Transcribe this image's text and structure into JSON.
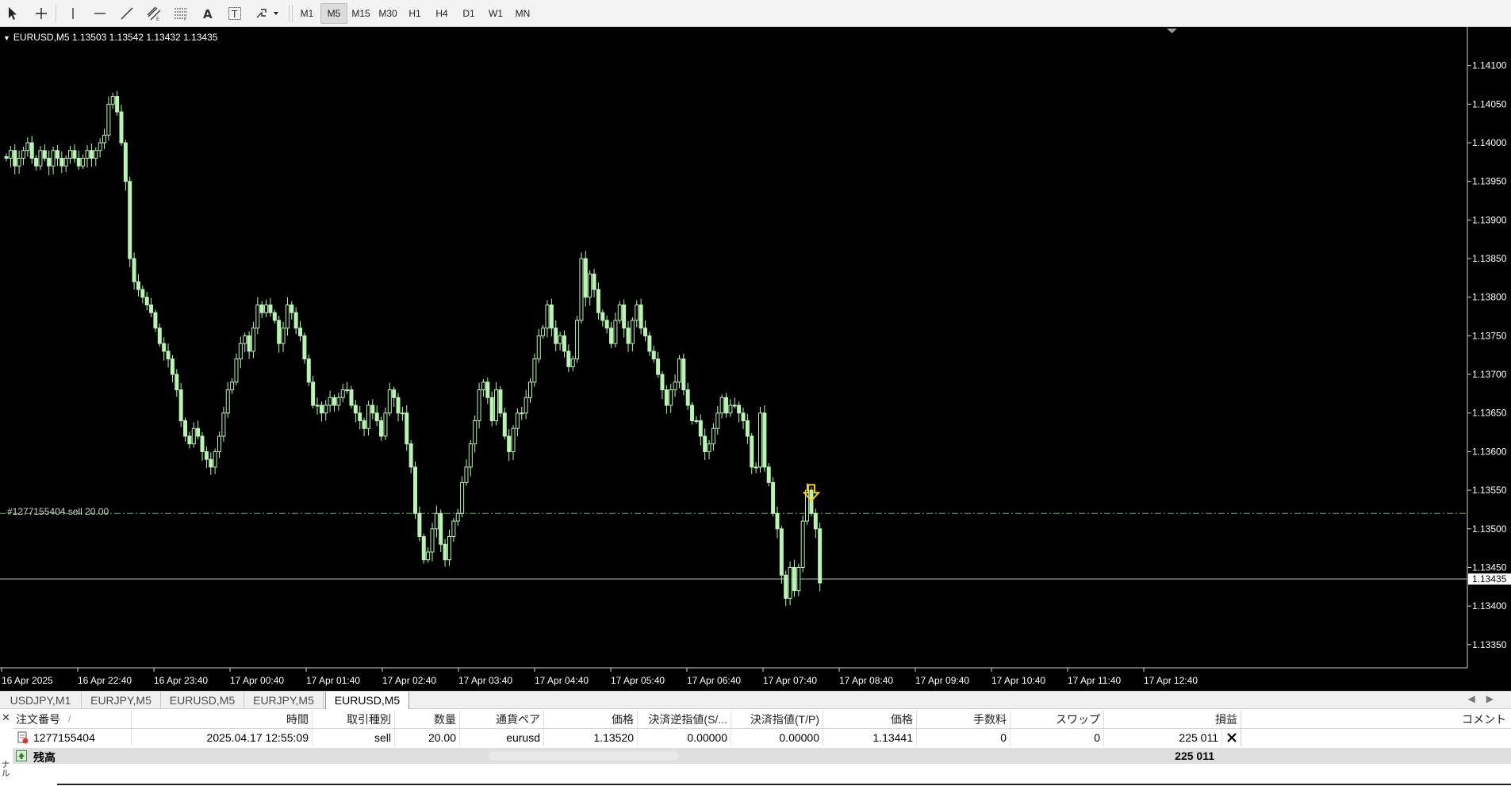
{
  "toolbar": {
    "timeframes": [
      "M1",
      "M5",
      "M15",
      "M30",
      "H1",
      "H4",
      "D1",
      "W1",
      "MN"
    ],
    "active_timeframe": "M5",
    "tools": [
      "cursor-icon",
      "crosshair-icon",
      "vertical-line-icon",
      "horizontal-line-icon",
      "trendline-icon",
      "equidistant-channel-icon",
      "fibonacci-icon",
      "text-icon",
      "text-label-icon",
      "arrows-icon"
    ]
  },
  "chart": {
    "title": "EURUSD,M5  1.13503 1.13542 1.13432 1.13435",
    "order_label": "#1277155404 sell 20.00",
    "current_price_label": "1.13435",
    "colors": {
      "background": "#000000",
      "candle": "#b8f5b0",
      "order_line": "#5fa85f",
      "arrow": "#ffd400",
      "axis_text": "#ffffff"
    }
  },
  "chart_data": {
    "type": "candlestick",
    "symbol": "EURUSD",
    "timeframe": "M5",
    "ylim": [
      1.1332,
      1.1415
    ],
    "price_ticks": [
      "1.14100",
      "1.14050",
      "1.14000",
      "1.13950",
      "1.13900",
      "1.13850",
      "1.13800",
      "1.13750",
      "1.13700",
      "1.13650",
      "1.13600",
      "1.13550",
      "1.13500",
      "1.13450",
      "1.13400",
      "1.13350"
    ],
    "time_ticks": [
      "16 Apr 2025",
      "16 Apr 22:40",
      "16 Apr 23:40",
      "17 Apr 00:40",
      "17 Apr 01:40",
      "17 Apr 02:40",
      "17 Apr 03:40",
      "17 Apr 04:40",
      "17 Apr 05:40",
      "17 Apr 06:40",
      "17 Apr 07:40",
      "17 Apr 08:40",
      "17 Apr 09:40",
      "17 Apr 10:40",
      "17 Apr 11:40",
      "17 Apr 12:40"
    ],
    "order_price": 1.1352,
    "current_price": 1.13435,
    "closes": [
      1.1398,
      1.1399,
      1.1397,
      1.1398,
      1.1399,
      1.14,
      1.1398,
      1.1397,
      1.1399,
      1.1398,
      1.1397,
      1.1399,
      1.1398,
      1.1397,
      1.1398,
      1.1399,
      1.1398,
      1.1397,
      1.1398,
      1.1399,
      1.1398,
      1.1399,
      1.14,
      1.1401,
      1.1405,
      1.1406,
      1.1404,
      1.14,
      1.1395,
      1.1385,
      1.1382,
      1.1381,
      1.138,
      1.1379,
      1.1378,
      1.1376,
      1.1374,
      1.1373,
      1.1372,
      1.137,
      1.1368,
      1.1364,
      1.1362,
      1.1361,
      1.1363,
      1.1362,
      1.136,
      1.1359,
      1.1358,
      1.136,
      1.1362,
      1.1365,
      1.1368,
      1.1369,
      1.1372,
      1.1374,
      1.1375,
      1.1373,
      1.1376,
      1.1379,
      1.1378,
      1.1379,
      1.1378,
      1.1377,
      1.1374,
      1.1376,
      1.1379,
      1.1378,
      1.1376,
      1.1375,
      1.1372,
      1.1369,
      1.1366,
      1.1366,
      1.1365,
      1.1366,
      1.1367,
      1.1366,
      1.1367,
      1.1368,
      1.1368,
      1.1366,
      1.1365,
      1.1364,
      1.1363,
      1.1366,
      1.1365,
      1.1364,
      1.1362,
      1.1365,
      1.1368,
      1.1367,
      1.1365,
      1.1365,
      1.1361,
      1.1358,
      1.1352,
      1.1349,
      1.1346,
      1.1347,
      1.135,
      1.1352,
      1.1348,
      1.1346,
      1.1349,
      1.1351,
      1.1352,
      1.1356,
      1.1358,
      1.1361,
      1.1364,
      1.1368,
      1.1369,
      1.1367,
      1.1364,
      1.1368,
      1.1365,
      1.1362,
      1.136,
      1.1363,
      1.1365,
      1.1365,
      1.1367,
      1.1369,
      1.1372,
      1.1375,
      1.1376,
      1.1379,
      1.1376,
      1.1374,
      1.1375,
      1.1373,
      1.1371,
      1.1372,
      1.1377,
      1.1385,
      1.138,
      1.1383,
      1.1381,
      1.1378,
      1.1377,
      1.1376,
      1.1374,
      1.1377,
      1.1379,
      1.1376,
      1.1374,
      1.1377,
      1.1379,
      1.1376,
      1.1375,
      1.1373,
      1.1372,
      1.137,
      1.1368,
      1.1366,
      1.1368,
      1.1369,
      1.1372,
      1.1368,
      1.1366,
      1.1364,
      1.1364,
      1.1362,
      1.136,
      1.1361,
      1.1363,
      1.1365,
      1.1367,
      1.1365,
      1.1366,
      1.1366,
      1.1365,
      1.1364,
      1.1362,
      1.1358,
      1.1358,
      1.1365,
      1.1358,
      1.1356,
      1.1352,
      1.135,
      1.1344,
      1.1341,
      1.1345,
      1.1342,
      1.1345,
      1.1351,
      1.1355,
      1.1352,
      1.135,
      1.1343
    ]
  },
  "tabs": [
    "USDJPY,M1",
    "EURJPY,M5",
    "EURUSD,M5",
    "EURJPY,M5",
    "EURUSD,M5"
  ],
  "active_tab": 4,
  "terminal": {
    "columns": [
      "注文番号",
      "時間",
      "取引種別",
      "数量",
      "通貨ペア",
      "価格",
      "決済逆指値(S/...",
      "決済指値(T/P)",
      "価格",
      "手数料",
      "スワップ",
      "損益",
      "コメント"
    ],
    "sort_marker": "/",
    "rows": [
      {
        "order": "1277155404",
        "time": "2025.04.17 12:55:09",
        "type": "sell",
        "volume": "20.00",
        "symbol": "eurusd",
        "price": "1.13520",
        "sl": "0.00000",
        "tp": "0.00000",
        "current": "1.13441",
        "commission": "0",
        "swap": "0",
        "profit": "225 011"
      }
    ],
    "balance_label": "残高",
    "balance_profit": "225 011",
    "side_label": "ナル"
  }
}
